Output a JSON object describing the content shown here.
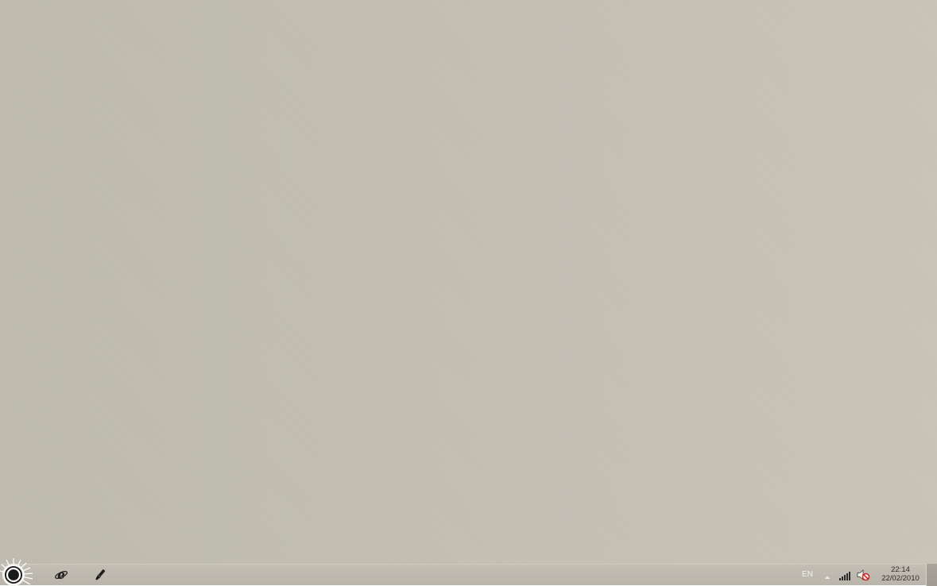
{
  "taskbar": {
    "start_button_icon": "start-orb-icon",
    "pinned": [
      {
        "name": "internet-explorer",
        "icon": "internet-explorer-icon"
      },
      {
        "name": "paint",
        "icon": "paint-brush-icon"
      }
    ],
    "tray": {
      "language": "EN",
      "overflow_icon": "up-arrow-icon",
      "network_icon": "signal-bars-icon",
      "volume_icon": "volume-muted-icon",
      "time": "22:14",
      "date": "22/02/2010"
    }
  },
  "colors": {
    "desktop_background": "#c4c0b4",
    "taskbar_background": "#bcb8ad",
    "mute_red": "#d42020"
  }
}
